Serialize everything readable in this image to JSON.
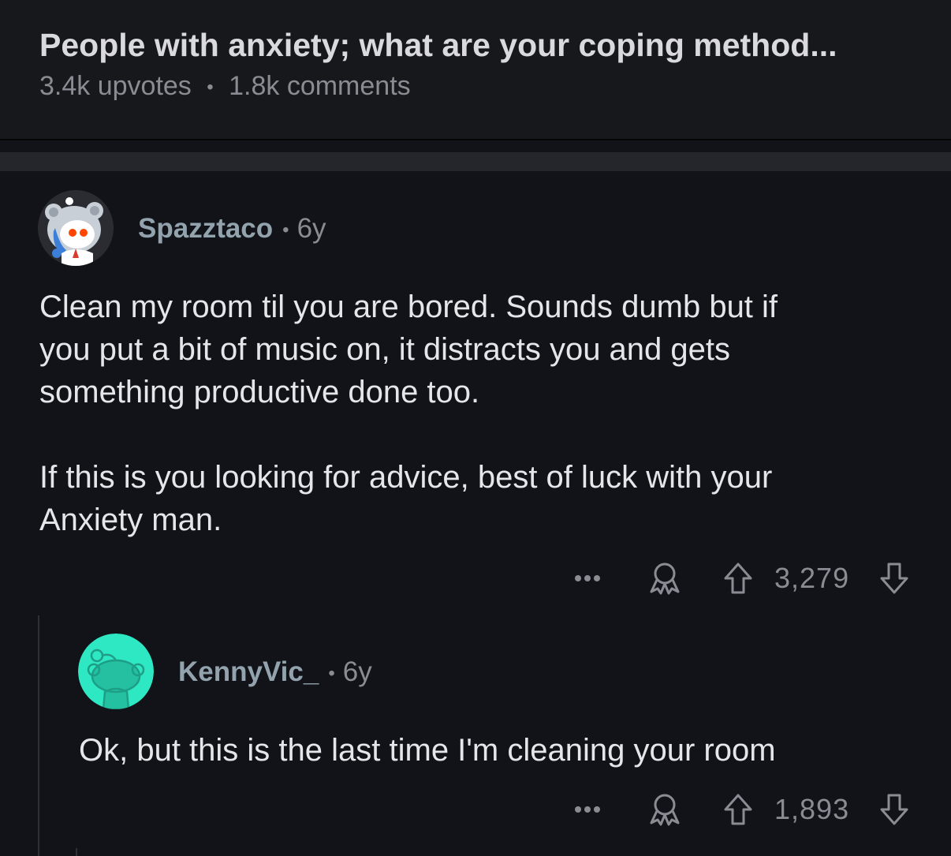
{
  "post": {
    "title": "People with anxiety; what are your coping method...",
    "upvotes": "3.4k upvotes",
    "separator": "•",
    "comments": "1.8k comments"
  },
  "comments": [
    {
      "author": "Spazztaco",
      "separator": "•",
      "age": "6y",
      "body": "Clean my room til you are bored. Sounds dumb but if\nyou put a bit of music on, it distracts you and gets\nsomething productive done too.\n\nIf this is you looking for advice, best of luck with your\nAnxiety man.",
      "score": "3,279"
    },
    {
      "author": "KennyVic_",
      "separator": "•",
      "age": "6y",
      "body": "Ok, but this is the last time I'm cleaning your room",
      "score": "1,893"
    }
  ],
  "icons": {
    "more": "more-options-icon",
    "award": "award-icon",
    "upvote": "upvote-arrow-icon",
    "downvote": "downvote-arrow-icon"
  },
  "colors": {
    "background": "#121318",
    "header_background": "#17181c",
    "text": "#e6e6ea",
    "meta": "#8a8c93",
    "username": "#93a3ad",
    "avatar2_bg": "#2ee8c4"
  }
}
